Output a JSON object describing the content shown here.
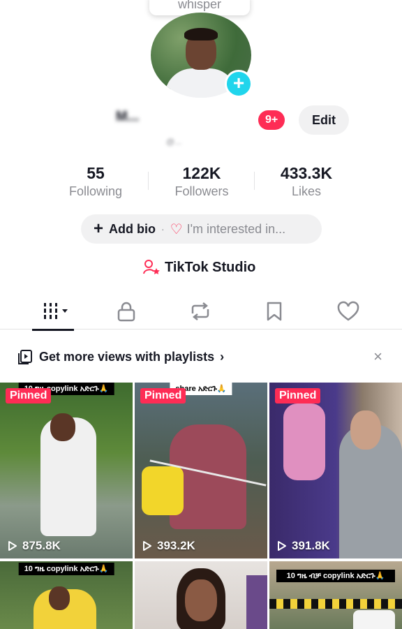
{
  "profile": {
    "whisper_label": "whisper",
    "username": "M...",
    "notification_count": "9+",
    "edit_label": "Edit",
    "handle": "@...",
    "stats": [
      {
        "value": "55",
        "label": "Following"
      },
      {
        "value": "122K",
        "label": "Followers"
      },
      {
        "value": "433.3K",
        "label": "Likes"
      }
    ],
    "add_bio_label": "Add bio",
    "interest_label": "I'm interested in...",
    "studio_label": "TikTok Studio"
  },
  "tabs": [
    {
      "name": "videos",
      "icon": "grid-icon",
      "active": true
    },
    {
      "name": "private",
      "icon": "lock-icon",
      "active": false
    },
    {
      "name": "reposts",
      "icon": "repost-icon",
      "active": false
    },
    {
      "name": "favorites",
      "icon": "bookmark-icon",
      "active": false
    },
    {
      "name": "liked",
      "icon": "heart-icon",
      "active": false
    }
  ],
  "playlist_banner": {
    "text": "Get more views with playlists",
    "chevron": "›",
    "close": "×"
  },
  "videos": [
    {
      "pinned": "Pinned",
      "views": "875.8K",
      "caption": "10 ግዜ copylink አድርጉ🙏"
    },
    {
      "pinned": "Pinned",
      "views": "393.2K",
      "caption": "share አድርጉ🙏"
    },
    {
      "pinned": "Pinned",
      "views": "391.8K",
      "caption": ""
    },
    {
      "pinned": "",
      "views": "",
      "caption": "10 ግዜ copylink አድርጉ🙏"
    },
    {
      "pinned": "",
      "views": "",
      "caption": ""
    },
    {
      "pinned": "",
      "views": "",
      "caption": "10 ግዜ ብቻ copylink አድርጉ🙏"
    }
  ],
  "colors": {
    "accent": "#fe2c55",
    "plus_button": "#20d5ec",
    "text": "#161823",
    "muted": "#8a8b91"
  }
}
